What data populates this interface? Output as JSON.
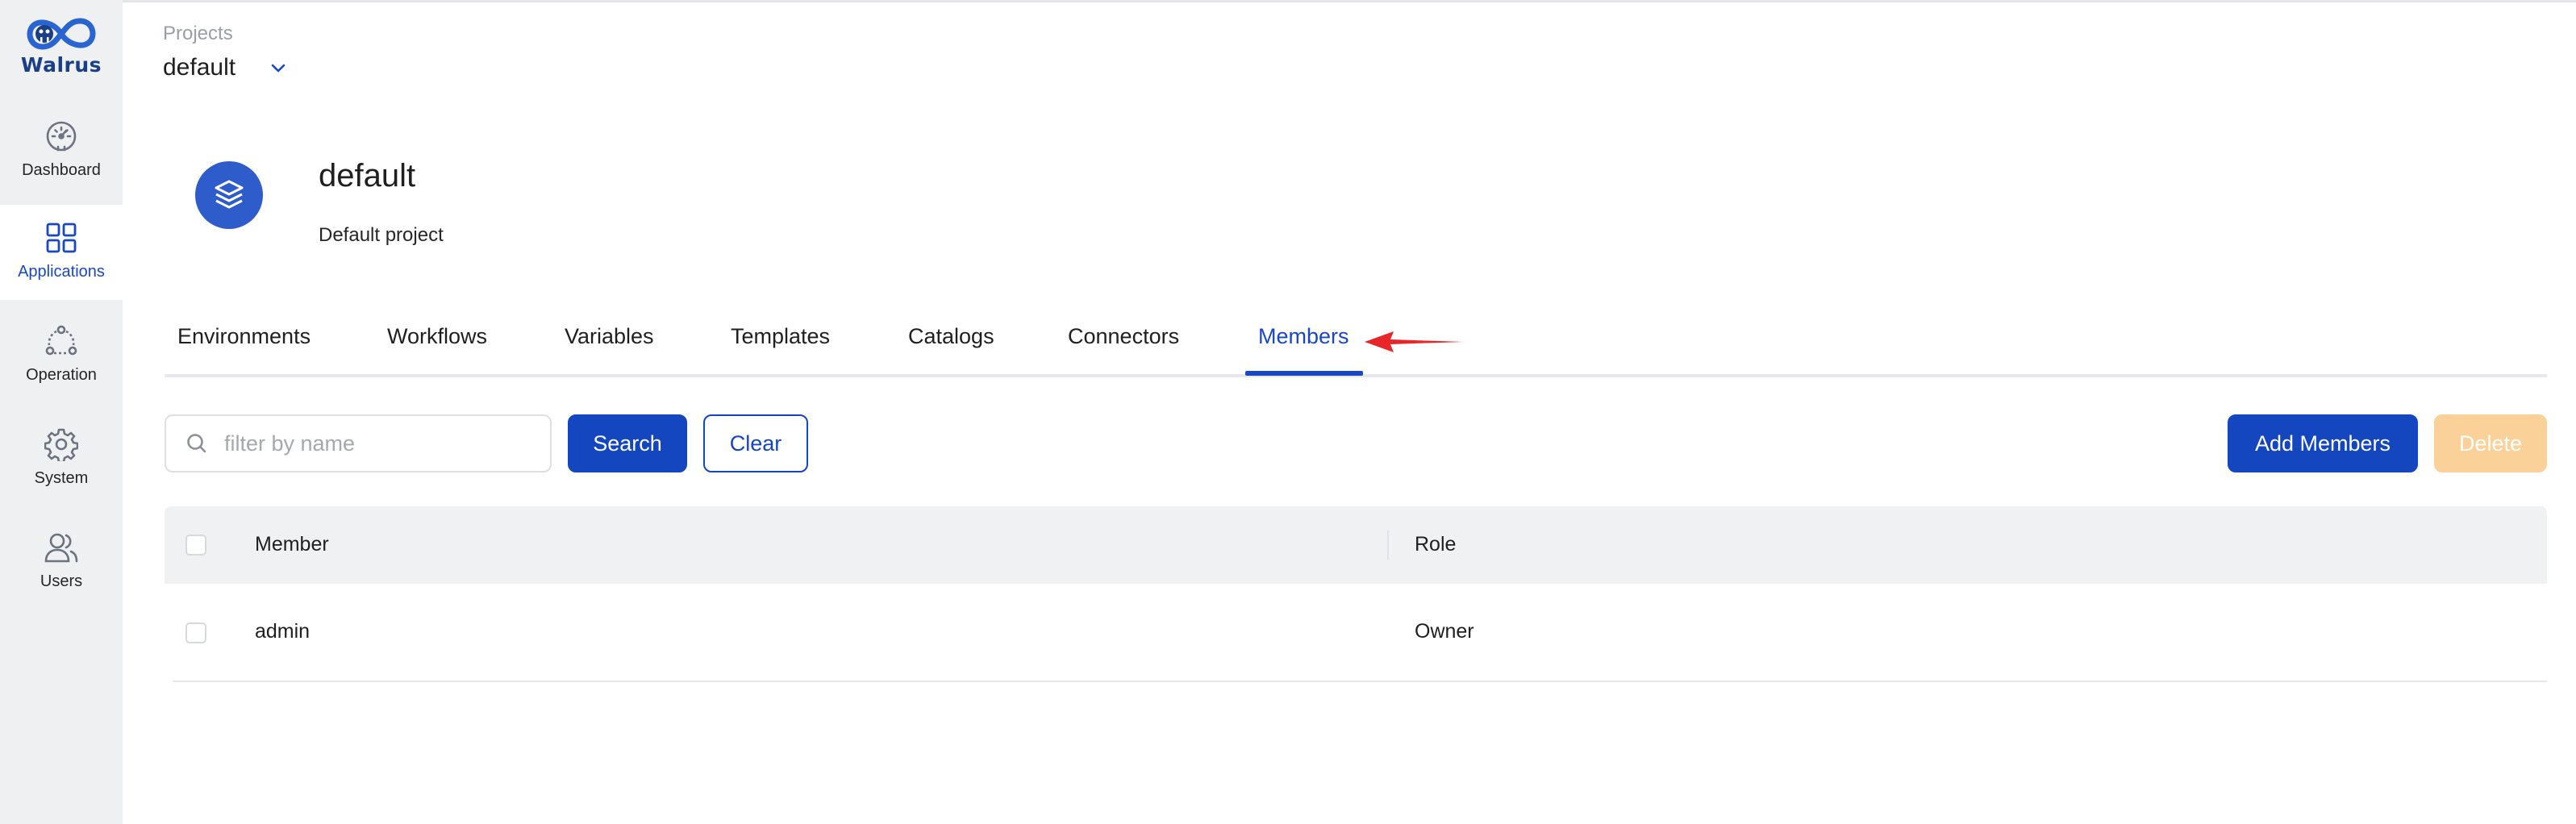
{
  "brand": {
    "name": "Walrus"
  },
  "sidebar": {
    "items": [
      {
        "label": "Dashboard",
        "icon": "dashboard-icon",
        "active": false
      },
      {
        "label": "Applications",
        "icon": "applications-grid-icon",
        "active": true
      },
      {
        "label": "Operation",
        "icon": "operation-icon",
        "active": false
      },
      {
        "label": "System",
        "icon": "gear-icon",
        "active": false
      },
      {
        "label": "Users",
        "icon": "users-icon",
        "active": false
      }
    ]
  },
  "header": {
    "projects_label": "Projects",
    "project_selected": "default"
  },
  "project": {
    "name": "default",
    "description": "Default project",
    "icon": "layers-icon"
  },
  "tabs": [
    {
      "label": "Environments"
    },
    {
      "label": "Workflows"
    },
    {
      "label": "Variables"
    },
    {
      "label": "Templates"
    },
    {
      "label": "Catalogs"
    },
    {
      "label": "Connectors"
    },
    {
      "label": "Members",
      "active": true
    }
  ],
  "toolbar": {
    "search_placeholder": "filter by name",
    "search_value": "",
    "search_label": "Search",
    "clear_label": "Clear",
    "add_members_label": "Add Members",
    "delete_label": "Delete"
  },
  "table": {
    "columns": [
      "Member",
      "Role"
    ],
    "rows": [
      {
        "member": "admin",
        "role": "Owner"
      }
    ]
  },
  "colors": {
    "accent": "#1446c0",
    "active_nav_text": "#1a47c4",
    "disabled_delete": "#fbd19a",
    "annotation_arrow": "#e8262a"
  }
}
